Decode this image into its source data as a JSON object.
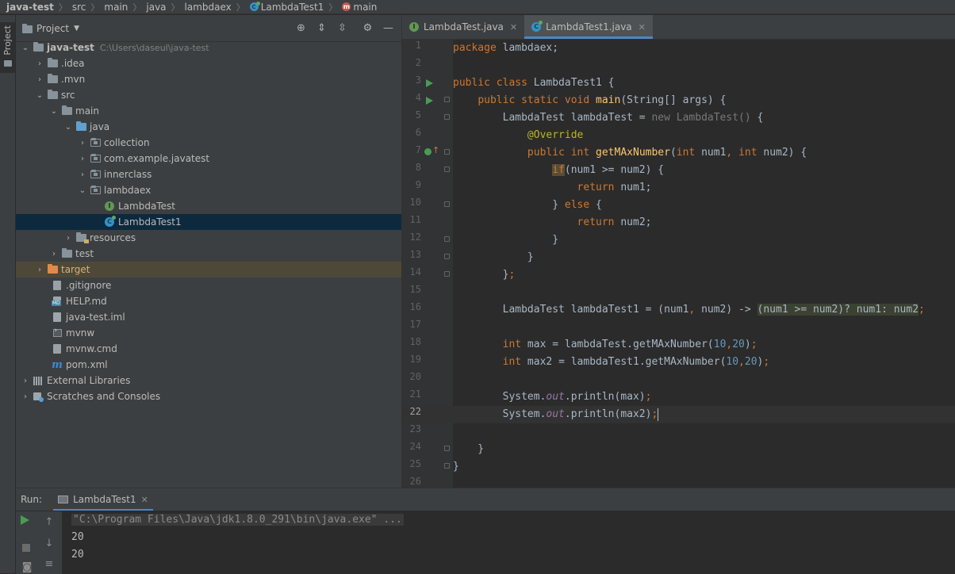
{
  "breadcrumb": [
    "java-test",
    "src",
    "main",
    "java",
    "lambdaex",
    "LambdaTest1",
    "main"
  ],
  "side_stripe": {
    "project_label": "Project"
  },
  "project_panel": {
    "title": "Project",
    "tree": [
      {
        "label": "java-test",
        "sub": "C:\\Users\\daseul\\java-test"
      },
      {
        "label": ".idea"
      },
      {
        "label": ".mvn"
      },
      {
        "label": "src"
      },
      {
        "label": "main"
      },
      {
        "label": "java"
      },
      {
        "label": "collection"
      },
      {
        "label": "com.example.javatest"
      },
      {
        "label": "innerclass"
      },
      {
        "label": "lambdaex"
      },
      {
        "label": "LambdaTest"
      },
      {
        "label": "LambdaTest1"
      },
      {
        "label": "resources"
      },
      {
        "label": "test"
      },
      {
        "label": "target"
      },
      {
        "label": ".gitignore"
      },
      {
        "label": "HELP.md"
      },
      {
        "label": "java-test.iml"
      },
      {
        "label": "mvnw"
      },
      {
        "label": "mvnw.cmd"
      },
      {
        "label": "pom.xml"
      },
      {
        "label": "External Libraries"
      },
      {
        "label": "Scratches and Consoles"
      }
    ]
  },
  "editor": {
    "tabs": [
      {
        "label": "LambdaTest.java"
      },
      {
        "label": "LambdaTest1.java"
      }
    ],
    "line_numbers": [
      "1",
      "2",
      "3",
      "4",
      "5",
      "6",
      "7",
      "8",
      "9",
      "10",
      "11",
      "12",
      "13",
      "14",
      "15",
      "16",
      "17",
      "18",
      "19",
      "20",
      "21",
      "22",
      "23",
      "24",
      "25",
      "26"
    ]
  },
  "run_panel": {
    "label": "Run:",
    "tab_label": "LambdaTest1",
    "output": [
      "\"C:\\Program Files\\Java\\jdk1.8.0_291\\bin\\java.exe\" ...",
      "20",
      "20"
    ]
  },
  "colors": {
    "keyword": "#cc7832",
    "function": "#ffc66d",
    "number": "#6897bb",
    "annotation": "#bbb529",
    "field": "#9876aa",
    "selection": "#0d293e",
    "active_tab_underline": "#4a88c7"
  }
}
